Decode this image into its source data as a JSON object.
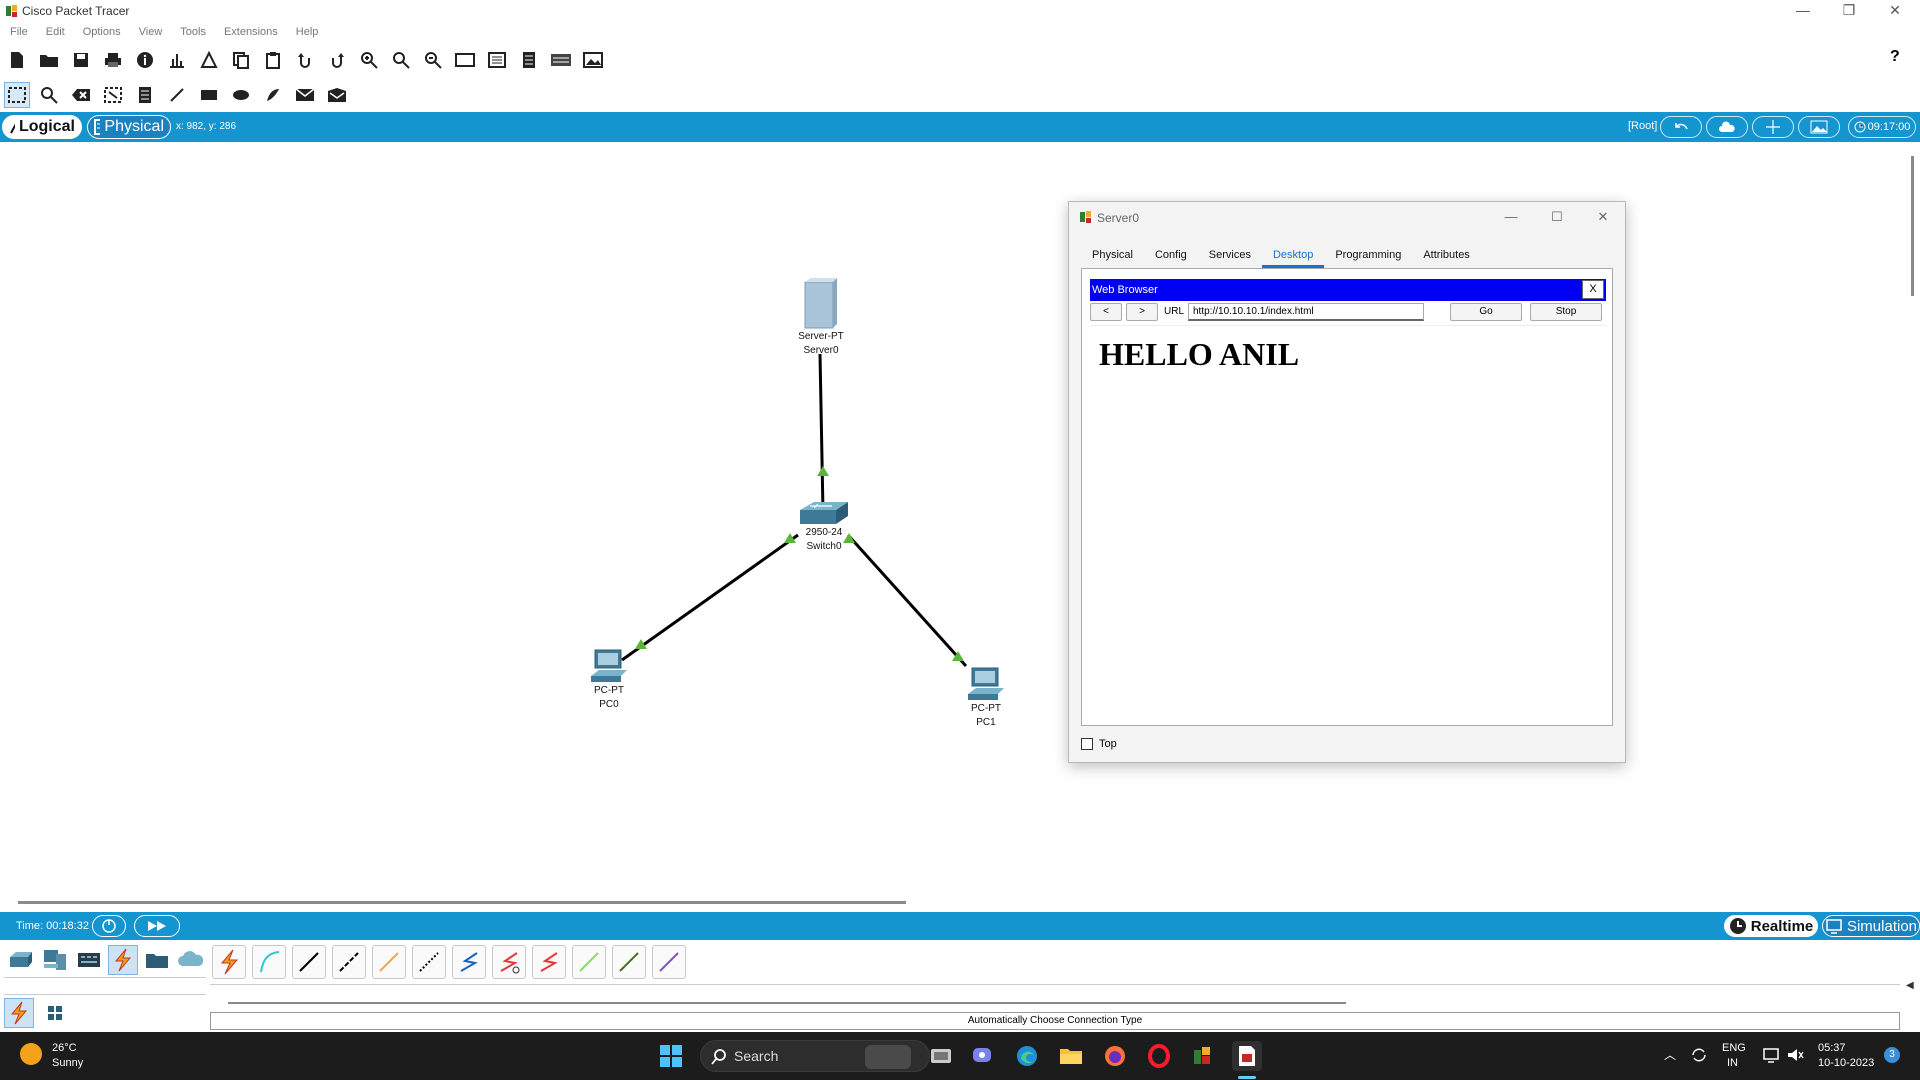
{
  "window": {
    "title": "Cisco Packet Tracer",
    "minimize": "—",
    "restore": "❐",
    "close": "✕"
  },
  "menu": [
    "File",
    "Edit",
    "Options",
    "View",
    "Tools",
    "Extensions",
    "Help"
  ],
  "help_label": "?",
  "view_bar": {
    "logical_label": "Logical",
    "physical_label": "Physical",
    "coords": "x: 982, y: 286",
    "root_label": "[Root]",
    "clock": "09:17:00"
  },
  "devices": {
    "server": {
      "type": "Server-PT",
      "name": "Server0"
    },
    "switch": {
      "type": "2950-24",
      "name": "Switch0"
    },
    "pc0": {
      "type": "PC-PT",
      "name": "PC0"
    },
    "pc1": {
      "type": "PC-PT",
      "name": "PC1"
    }
  },
  "dialog": {
    "title": "Server0",
    "tabs": [
      "Physical",
      "Config",
      "Services",
      "Desktop",
      "Programming",
      "Attributes"
    ],
    "active_tab": "Desktop",
    "browser": {
      "title": "Web Browser",
      "close_label": "X",
      "back_label": "<",
      "forward_label": ">",
      "url_label": "URL",
      "url": "http://10.10.10.1/index.html",
      "go_label": "Go",
      "stop_label": "Stop",
      "page_heading": "HELLO ANIL"
    },
    "top_label": "Top"
  },
  "sim_bar": {
    "time": "Time: 00:18:32",
    "realtime_label": "Realtime",
    "simulation_label": "Simulation"
  },
  "status_message": "Automatically Choose Connection Type",
  "taskbar": {
    "temperature": "26°C",
    "weather": "Sunny",
    "search_placeholder": "Search",
    "lang_line1": "ENG",
    "lang_line2": "IN",
    "time": "05:37",
    "date": "10-10-2023",
    "notification_count": "3"
  },
  "colors": {
    "accent_blue": "#1495d0",
    "browser_title": "#0000f5",
    "link_green": "#5cb53a"
  }
}
